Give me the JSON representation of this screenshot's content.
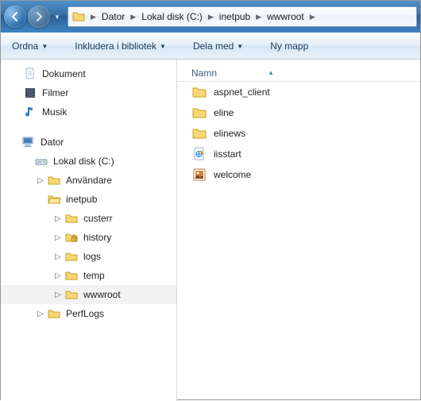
{
  "breadcrumb": {
    "segments": [
      "Dator",
      "Lokal disk (C:)",
      "inetpub",
      "wwwroot"
    ]
  },
  "toolbar": {
    "organize": "Ordna",
    "include": "Inkludera i bibliotek",
    "share": "Dela med",
    "newfolder": "Ny mapp"
  },
  "tree": {
    "libraries": {
      "documents": "Dokument",
      "videos": "Filmer",
      "music": "Musik"
    },
    "computer": {
      "label": "Dator",
      "drive": "Lokal disk (C:)",
      "folders": {
        "users": "Användare",
        "inetpub": "inetpub",
        "custerr": "custerr",
        "history": "history",
        "logs": "logs",
        "temp": "temp",
        "wwwroot": "wwwroot",
        "perflogs": "PerfLogs"
      }
    }
  },
  "list": {
    "header_name": "Namn",
    "items": [
      {
        "name": "aspnet_client",
        "type": "folder"
      },
      {
        "name": "eline",
        "type": "folder"
      },
      {
        "name": "elinews",
        "type": "folder"
      },
      {
        "name": "iisstart",
        "type": "html"
      },
      {
        "name": "welcome",
        "type": "image"
      }
    ]
  }
}
